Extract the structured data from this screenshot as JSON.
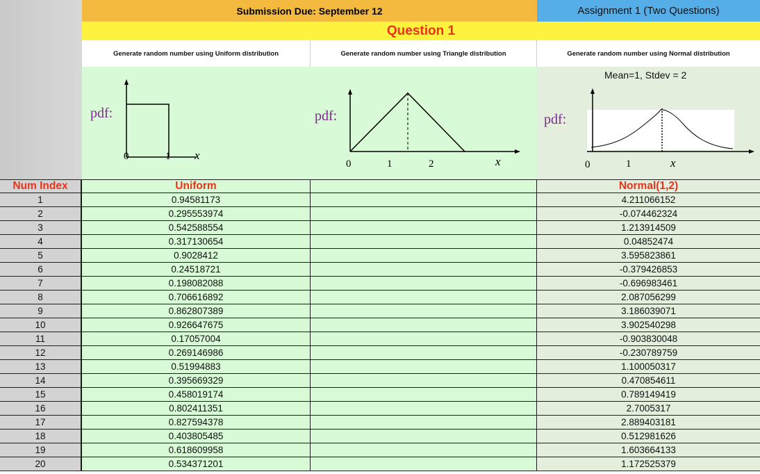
{
  "header": {
    "submission": "Submission Due:  September 12",
    "assignment": "Assignment 1 (Two Questions)",
    "question": "Question 1"
  },
  "descriptions": {
    "uniform": "Generate random number using Uniform distribution",
    "triangle": "Generate random number using Triangle distribution",
    "normal": "Generate random number using Normal distribution"
  },
  "diagrams": {
    "pdf_label": "pdf:",
    "x_label": "x",
    "uniform_ticks": [
      "0",
      "1"
    ],
    "triangle_ticks": [
      "0",
      "1",
      "2"
    ],
    "normal_ticks": [
      "0",
      "1"
    ],
    "normal_caption": "Mean=1, Stdev = 2"
  },
  "table": {
    "headers": {
      "index": "Num Index",
      "uniform": "Uniform",
      "triangle": "",
      "normal": "Normal(1,2)"
    },
    "rows": [
      {
        "index": "1",
        "uniform": "0.94581173",
        "normal": "4.211066152"
      },
      {
        "index": "2",
        "uniform": "0.295553974",
        "normal": "-0.074462324"
      },
      {
        "index": "3",
        "uniform": "0.542588554",
        "normal": "1.213914509"
      },
      {
        "index": "4",
        "uniform": "0.317130654",
        "normal": "0.04852474"
      },
      {
        "index": "5",
        "uniform": "0.9028412",
        "normal": "3.595823861"
      },
      {
        "index": "6",
        "uniform": "0.24518721",
        "normal": "-0.379426853"
      },
      {
        "index": "7",
        "uniform": "0.198082088",
        "normal": "-0.696983461"
      },
      {
        "index": "8",
        "uniform": "0.706616892",
        "normal": "2.087056299"
      },
      {
        "index": "9",
        "uniform": "0.862807389",
        "normal": "3.186039071"
      },
      {
        "index": "10",
        "uniform": "0.926647675",
        "normal": "3.902540298"
      },
      {
        "index": "11",
        "uniform": "0.17057004",
        "normal": "-0.903830048"
      },
      {
        "index": "12",
        "uniform": "0.269146986",
        "normal": "-0.230789759"
      },
      {
        "index": "13",
        "uniform": "0.51994883",
        "normal": "1.100050317"
      },
      {
        "index": "14",
        "uniform": "0.395669329",
        "normal": "0.470854611"
      },
      {
        "index": "15",
        "uniform": "0.458019174",
        "normal": "0.789149419"
      },
      {
        "index": "16",
        "uniform": "0.802411351",
        "normal": "2.7005317"
      },
      {
        "index": "17",
        "uniform": "0.827594378",
        "normal": "2.889403181"
      },
      {
        "index": "18",
        "uniform": "0.403805485",
        "normal": "0.512981626"
      },
      {
        "index": "19",
        "uniform": "0.618609958",
        "normal": "1.603664133"
      },
      {
        "index": "20",
        "uniform": "0.534371201",
        "normal": "1.172525379"
      }
    ]
  }
}
